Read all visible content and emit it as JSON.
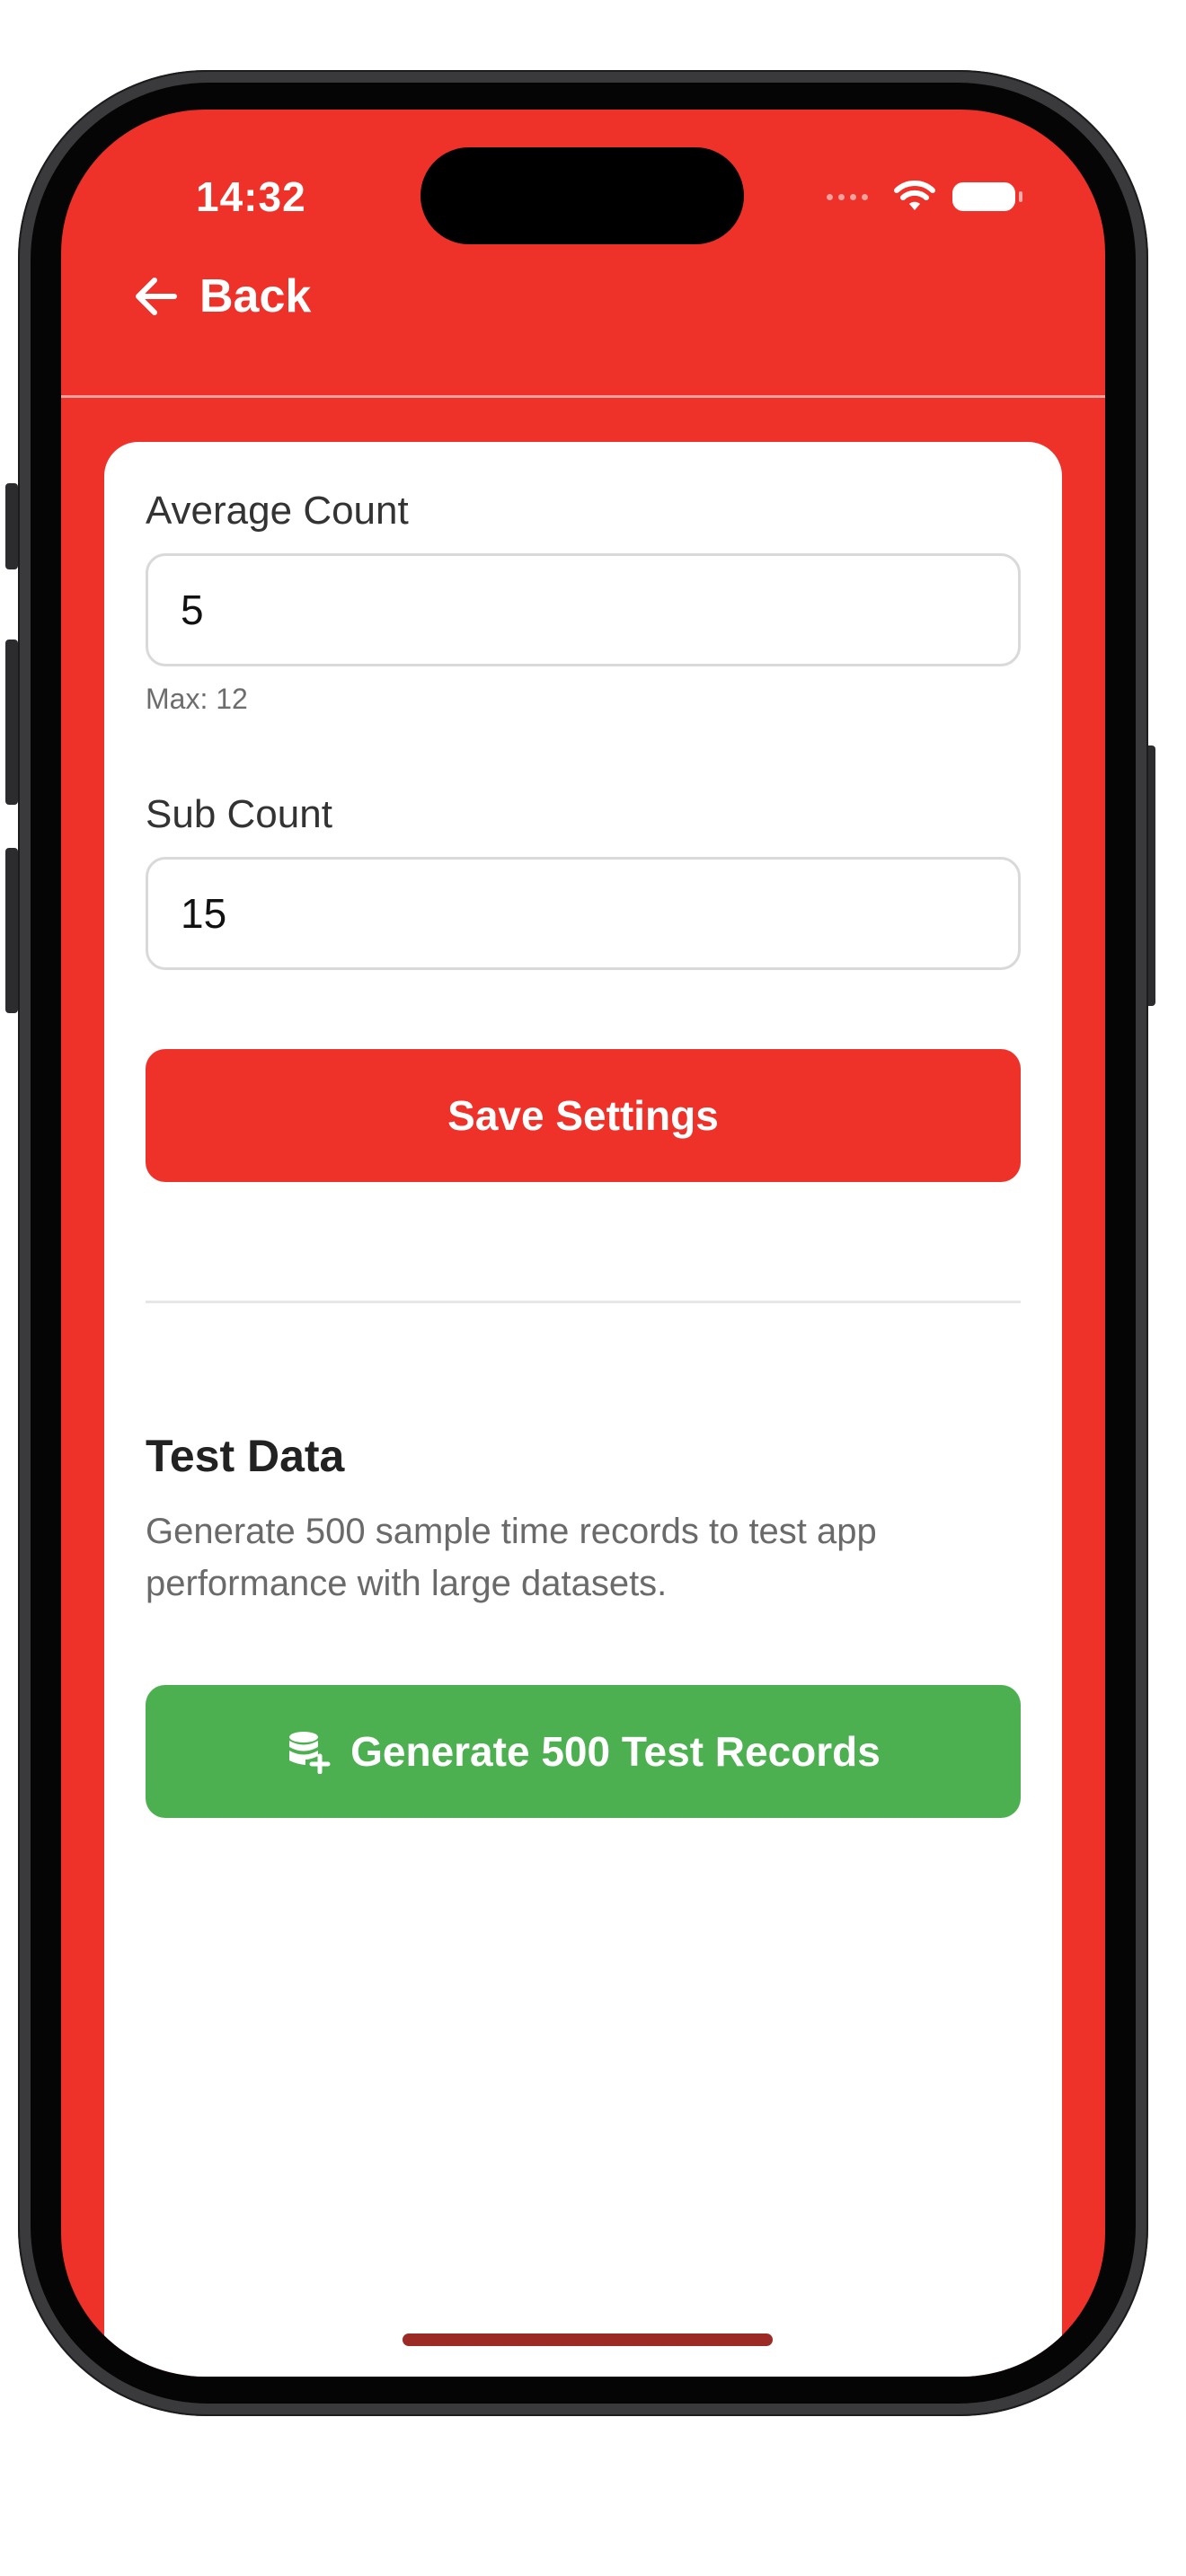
{
  "status_bar": {
    "time": "14:32"
  },
  "nav": {
    "back_label": "Back",
    "back_icon": "arrow-left-icon"
  },
  "settings": {
    "average_count": {
      "label": "Average Count",
      "value": "5",
      "hint": "Max: 12"
    },
    "sub_count": {
      "label": "Sub Count",
      "value": "15"
    },
    "save_label": "Save Settings"
  },
  "test_data": {
    "title": "Test Data",
    "description": "Generate 500 sample time records to test app performance with large datasets.",
    "generate_label": "Generate 500 Test Records",
    "generate_icon": "database-add-icon"
  },
  "colors": {
    "accent_red": "#ee3129",
    "success_green": "#4caf50"
  }
}
